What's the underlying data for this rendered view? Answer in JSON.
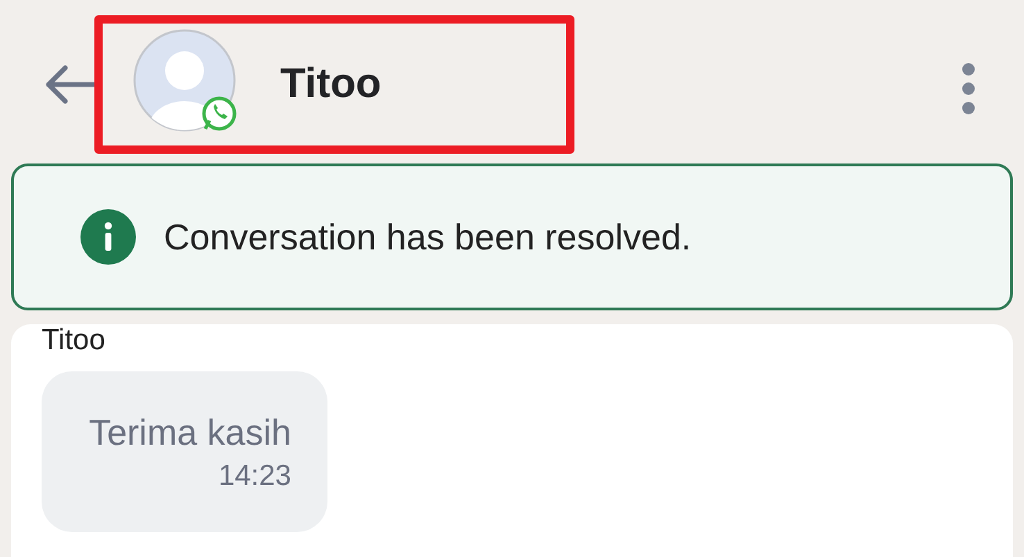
{
  "header": {
    "contact_name": "Titoo",
    "highlighted": true
  },
  "banner": {
    "kind": "info",
    "text": "Conversation has been resolved."
  },
  "messages": [
    {
      "sender": "Titoo",
      "text": "Terima kasih",
      "time": "14:23"
    }
  ]
}
